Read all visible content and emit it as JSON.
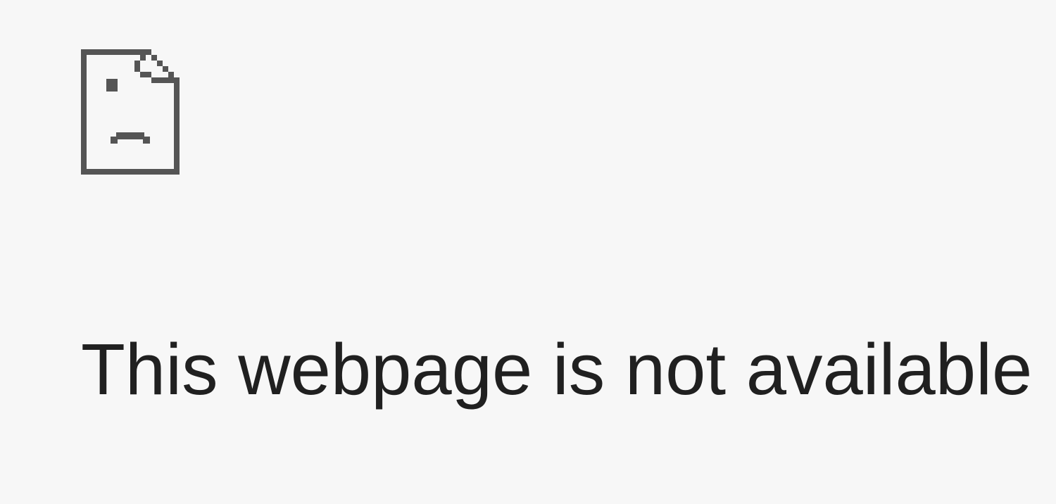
{
  "error": {
    "heading": "This webpage is not available",
    "icon_name": "sad-file-icon"
  }
}
